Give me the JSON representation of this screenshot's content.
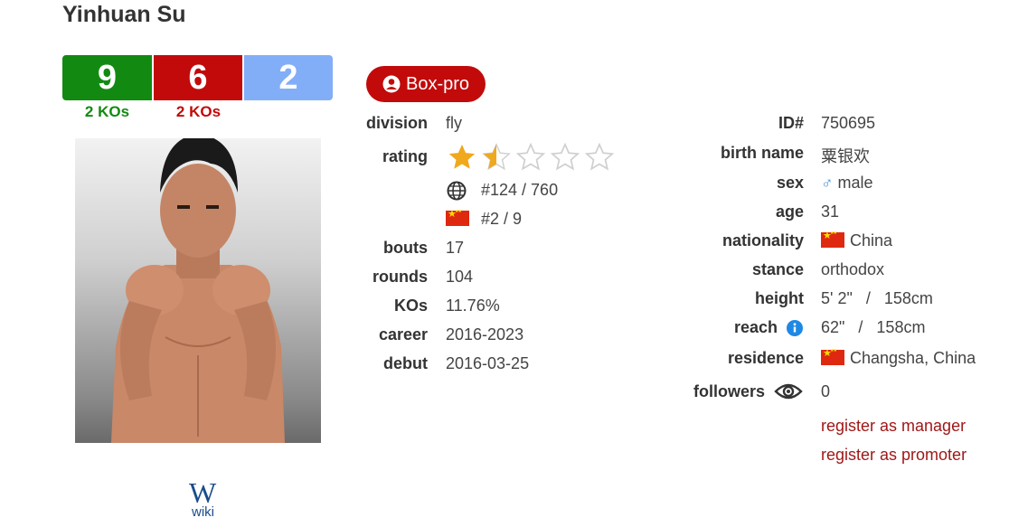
{
  "name": "Yinhuan Su",
  "record": {
    "wins": "9",
    "losses": "6",
    "draws": "2",
    "wins_kos": "2 KOs",
    "losses_kos": "2 KOs"
  },
  "wiki_label": "wiki",
  "badge": "Box-pro",
  "left": {
    "division_label": "division",
    "division": "fly",
    "rating_label": "rating",
    "rating_stars": 1.5,
    "rating_stars_max": 5,
    "world_rank": "#124 / 760",
    "national_rank": "#2 / 9",
    "bouts_label": "bouts",
    "bouts": "17",
    "rounds_label": "rounds",
    "rounds": "104",
    "kos_label": "KOs",
    "kos": "11.76%",
    "career_label": "career",
    "career": "2016-2023",
    "debut_label": "debut",
    "debut": "2016-03-25"
  },
  "right": {
    "id_label": "ID#",
    "id": "750695",
    "birth_name_label": "birth name",
    "birth_name": "粟银欢",
    "sex_label": "sex",
    "sex": "male",
    "age_label": "age",
    "age": "31",
    "nationality_label": "nationality",
    "nationality": "China",
    "stance_label": "stance",
    "stance": "orthodox",
    "height_label": "height",
    "height": "5' 2\"   /   158cm",
    "reach_label": "reach",
    "reach": "62\"   /   158cm",
    "residence_label": "residence",
    "residence": "Changsha, China",
    "followers_label": "followers",
    "followers": "0"
  },
  "links": {
    "manager": "register as manager",
    "promoter": "register as promoter"
  },
  "colors": {
    "win": "#128a12",
    "loss": "#c20a0a",
    "draw": "#82aef7",
    "star": "#f0a81c",
    "link": "#a01818",
    "info": "#1e88e5"
  }
}
